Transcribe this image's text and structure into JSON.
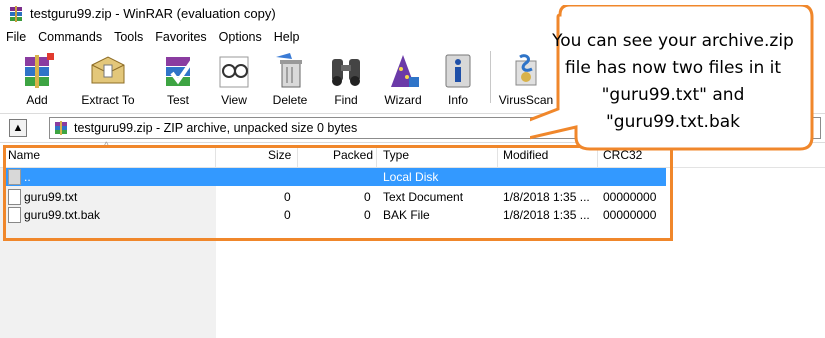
{
  "window": {
    "title": "testguru99.zip - WinRAR (evaluation copy)"
  },
  "menu": [
    "File",
    "Commands",
    "Tools",
    "Favorites",
    "Options",
    "Help"
  ],
  "toolbar": [
    {
      "label": "Add",
      "icon": "add-icon"
    },
    {
      "label": "Extract To",
      "icon": "extract-to-icon"
    },
    {
      "label": "Test",
      "icon": "test-icon"
    },
    {
      "label": "View",
      "icon": "view-icon"
    },
    {
      "label": "Delete",
      "icon": "delete-icon"
    },
    {
      "label": "Find",
      "icon": "find-icon"
    },
    {
      "label": "Wizard",
      "icon": "wizard-icon"
    },
    {
      "label": "Info",
      "icon": "info-icon"
    },
    {
      "label": "VirusScan",
      "icon": "virusscan-icon"
    }
  ],
  "address": {
    "text": "testguru99.zip - ZIP archive, unpacked size 0 bytes"
  },
  "columns": [
    "Name",
    "Size",
    "Packed",
    "Type",
    "Modified",
    "CRC32"
  ],
  "rows": [
    {
      "name": "..",
      "size": "",
      "packed": "",
      "type": "Local Disk",
      "modified": "",
      "crc": ""
    },
    {
      "name": "guru99.txt",
      "size": "0",
      "packed": "0",
      "type": "Text Document",
      "modified": "1/8/2018 1:35 ...",
      "crc": "00000000"
    },
    {
      "name": "guru99.txt.bak",
      "size": "0",
      "packed": "0",
      "type": "BAK File",
      "modified": "1/8/2018 1:35 ...",
      "crc": "00000000"
    }
  ],
  "annotation": {
    "lines": [
      "You can see your archive.zip",
      "file has now two files in it",
      "\"guru99.txt\" and",
      "\"guru99.txt.bak"
    ]
  },
  "colors": {
    "accent": "#f0872b",
    "selection": "#3399ff"
  }
}
